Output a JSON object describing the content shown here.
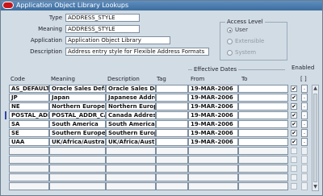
{
  "window": {
    "title": "Application Object Library Lookups"
  },
  "header": {
    "type_label": "Type",
    "type_value": "ADDRESS_STYLE",
    "meaning_label": "Meaning",
    "meaning_value": "ADDRESS_STYLE",
    "application_label": "Application",
    "application_value": "Application Object Library",
    "description_label": "Description",
    "description_value": "Address entry style for Flexible Address Formats"
  },
  "access_level": {
    "title": "Access Level",
    "options": [
      "User",
      "Extensible",
      "System"
    ],
    "selected": "User"
  },
  "table": {
    "effective_dates_label": "Effective Dates",
    "enabled_label": "Enabled",
    "brackets_label": "[ ]",
    "columns": {
      "code": "Code",
      "meaning": "Meaning",
      "description": "Description",
      "tag": "Tag",
      "from": "From",
      "to": "To"
    },
    "rows": [
      {
        "code": "AS_DEFAULT",
        "meaning": "Oracle Sales Default",
        "description": "Oracle Sales Default A",
        "tag": "",
        "from": "19-MAR-2006",
        "to": "",
        "enabled": "✔",
        "more": "."
      },
      {
        "code": "JP",
        "meaning": "Japan",
        "description": "Japanese Address Styl",
        "tag": "",
        "from": "19-MAR-2006",
        "to": "",
        "enabled": "✔",
        "more": "."
      },
      {
        "code": "NE",
        "meaning": "Northern Europe",
        "description": "Northern European Ad",
        "tag": "",
        "from": "19-MAR-2006",
        "to": "",
        "enabled": "✔",
        "more": "."
      },
      {
        "code": "POSTAL_ADI",
        "meaning": "POSTAL_ADDR_CA",
        "description": "Canada Address Style",
        "tag": "",
        "from": "19-MAR-2006",
        "to": "",
        "enabled": "✔",
        "more": "."
      },
      {
        "code": "SA",
        "meaning": "South America",
        "description": "South American Addr",
        "tag": "",
        "from": "19-MAR-2006",
        "to": "",
        "enabled": "✔",
        "more": "."
      },
      {
        "code": "SE",
        "meaning": "Southern Europe",
        "description": "Southern European Ad",
        "tag": "",
        "from": "19-MAR-2006",
        "to": "",
        "enabled": "✔",
        "more": "."
      },
      {
        "code": "UAA",
        "meaning": "UK/Africa/Australasia",
        "description": "UK/Africa/Australasia /",
        "tag": "",
        "from": "19-MAR-2006",
        "to": "",
        "enabled": "✔",
        "more": "."
      },
      {
        "code": "",
        "meaning": "",
        "description": "",
        "tag": "",
        "from": "",
        "to": "",
        "enabled": "",
        "more": ""
      },
      {
        "code": "",
        "meaning": "",
        "description": "",
        "tag": "",
        "from": "",
        "to": "",
        "enabled": "",
        "more": ""
      },
      {
        "code": "",
        "meaning": "",
        "description": "",
        "tag": "",
        "from": "",
        "to": "",
        "enabled": "",
        "more": ""
      },
      {
        "code": "",
        "meaning": "",
        "description": "",
        "tag": "",
        "from": "",
        "to": "",
        "enabled": "",
        "more": ""
      },
      {
        "code": "",
        "meaning": "",
        "description": "",
        "tag": "",
        "from": "",
        "to": "",
        "enabled": "",
        "more": ""
      }
    ],
    "current_row": 4
  },
  "icons": {
    "title_icon": "oracle-logo-icon",
    "scroll_up": "arrow-up-icon",
    "scroll_down": "arrow-down-icon"
  },
  "colors": {
    "titlebar": "#3d6d9e",
    "background": "#d2dce4",
    "cursor": "#3144a8"
  }
}
